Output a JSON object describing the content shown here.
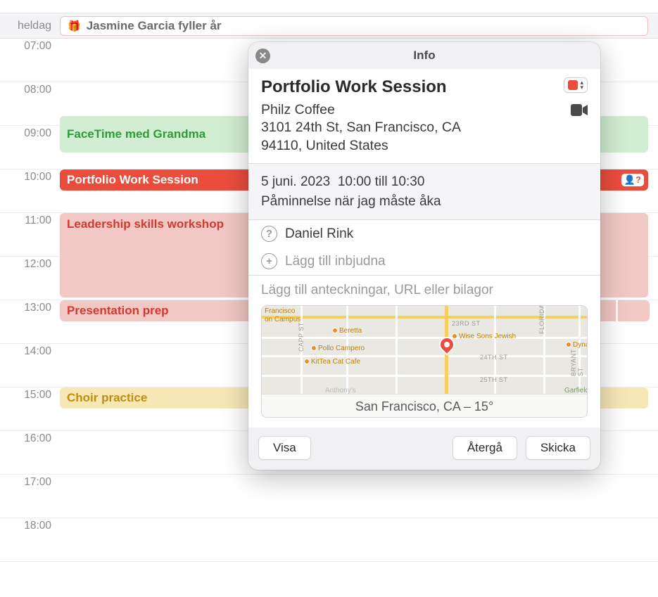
{
  "allday": {
    "label": "heldag",
    "event": "Jasmine Garcia fyller år"
  },
  "hours": [
    "07:00",
    "08:00",
    "09:00",
    "10:00",
    "11:00",
    "12:00",
    "13:00",
    "14:00",
    "15:00",
    "16:00",
    "17:00",
    "18:00"
  ],
  "events": {
    "facetime": "FaceTime med Grandma",
    "portfolio": "Portfolio Work Session",
    "leadership": "Leadership skills workshop",
    "presentation": "Presentation prep",
    "choir": "Choir practice"
  },
  "popover": {
    "header": "Info",
    "title": "Portfolio Work Session",
    "location_name": "Philz Coffee",
    "location_addr1": "3101 24th St, San Francisco, CA",
    "location_addr2": "94110, United States",
    "date": "5 juni. 2023",
    "time": "10:00 till 10:30",
    "reminder": "Påminnelse när jag måste åka",
    "invitee": "Daniel Rink",
    "add_invitee": "Lägg till inbjudna",
    "notes_placeholder": "Lägg till anteckningar, URL eller bilagor",
    "map": {
      "footer": "San Francisco, CA – 15°",
      "pois": {
        "francisco": "Francisco",
        "campus": "on Campus",
        "beretta": "Beretta",
        "pollo": "Pollo Campero",
        "kittea": "KitTea Cat Cafe",
        "wise": "Wise Sons Jewish",
        "dynamo": "Dynamo Coffee",
        "anthonys": "Anthony's",
        "garfield": "Garfield"
      },
      "streets": {
        "s23": "23RD ST",
        "s24": "24TH ST",
        "s25": "25TH ST",
        "capp": "CAPP ST",
        "florida": "FLORIDA ST",
        "bryant": "BRYANT ST"
      }
    },
    "buttons": {
      "show": "Visa",
      "revert": "Återgå",
      "send": "Skicka"
    },
    "calendar_color": "#eb4d3d"
  }
}
